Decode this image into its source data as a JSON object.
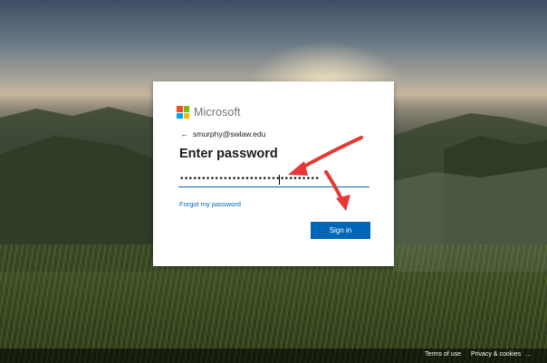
{
  "brand": {
    "name": "Microsoft"
  },
  "account": {
    "email": "smurphy@swlaw.edu",
    "back_icon": "arrow-left-icon"
  },
  "page": {
    "title": "Enter password"
  },
  "password": {
    "value": "••••••••••••••••••••••••••••••••"
  },
  "links": {
    "forgot": "Forgot my password"
  },
  "buttons": {
    "sign_in": "Sign in"
  },
  "footer": {
    "terms": "Terms of use",
    "privacy": "Privacy & cookies",
    "more": "..."
  },
  "colors": {
    "accent": "#0067b8",
    "annotation_arrow": "#e53935",
    "logo": [
      "#f25022",
      "#7fba00",
      "#00a4ef",
      "#ffb900"
    ]
  }
}
